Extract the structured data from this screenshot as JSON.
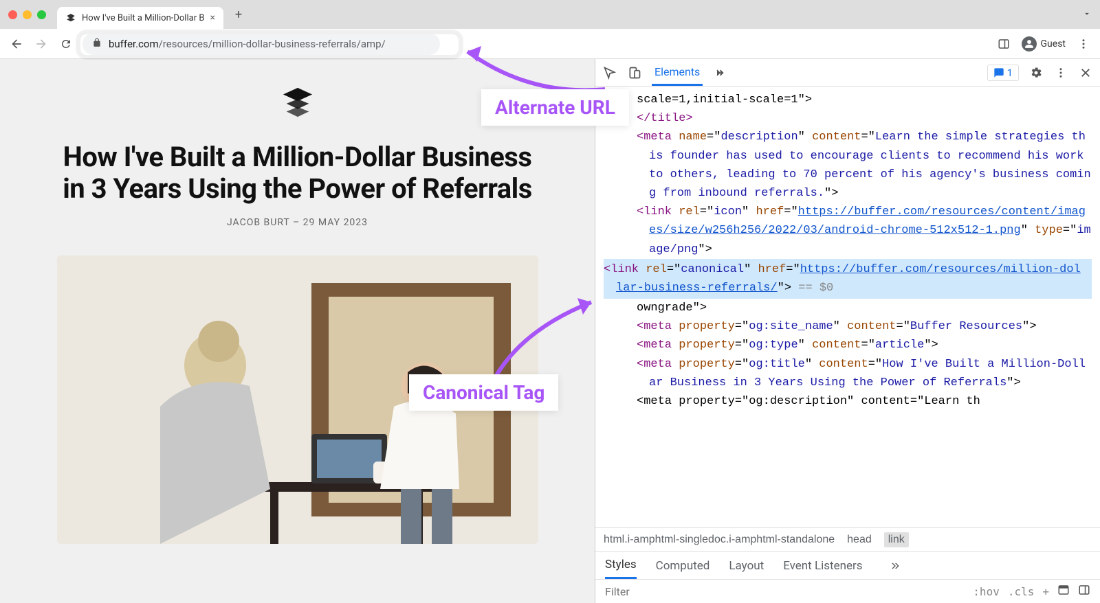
{
  "browser": {
    "tab_title": "How I've Built a Million-Dollar B",
    "url_domain": "buffer.com",
    "url_path": "/resources/million-dollar-business-referrals/amp/",
    "guest_label": "Guest"
  },
  "article": {
    "title": "How I've Built a Million-Dollar Business in 3 Years Using the Power of Referrals",
    "author": "JACOB BURT",
    "date": "29 MAY 2023"
  },
  "devtools": {
    "tabs": {
      "elements": "Elements"
    },
    "issues_count": "1",
    "meta_viewport_frag": "scale=1,initial-scale=1\">",
    "title_close": "</title>",
    "meta_description": "Learn the simple strategies this founder has used to encourage clients to recommend his work to others, leading to 70 percent of his agency's business coming from inbound referrals.",
    "icon_href": "https://buffer.com/resources/content/images/size/w256h256/2022/03/android-chrome-512x512-1.png",
    "icon_type": "image/png",
    "canonical_href": "https://buffer.com/resources/million-dollar-business-referrals/",
    "owngrade_frag": "owngrade\">",
    "og_site_name": "Buffer Resources",
    "og_type": "article",
    "og_title": "How I've Built a Million-Dollar Business in 3 Years Using the Power of Referrals",
    "og_desc_frag": "<meta property=\"og:description\" content=\"Learn th",
    "breadcrumb": {
      "html": "html.i-amphtml-singledoc.i-amphtml-standalone",
      "head": "head",
      "link": "link"
    },
    "styles_tabs": {
      "styles": "Styles",
      "computed": "Computed",
      "layout": "Layout",
      "events": "Event Listeners"
    },
    "filter_placeholder": "Filter",
    "hov": ":hov",
    "cls": ".cls"
  },
  "annotations": {
    "alternate_url": "Alternate URL",
    "canonical_tag": "Canonical Tag"
  }
}
